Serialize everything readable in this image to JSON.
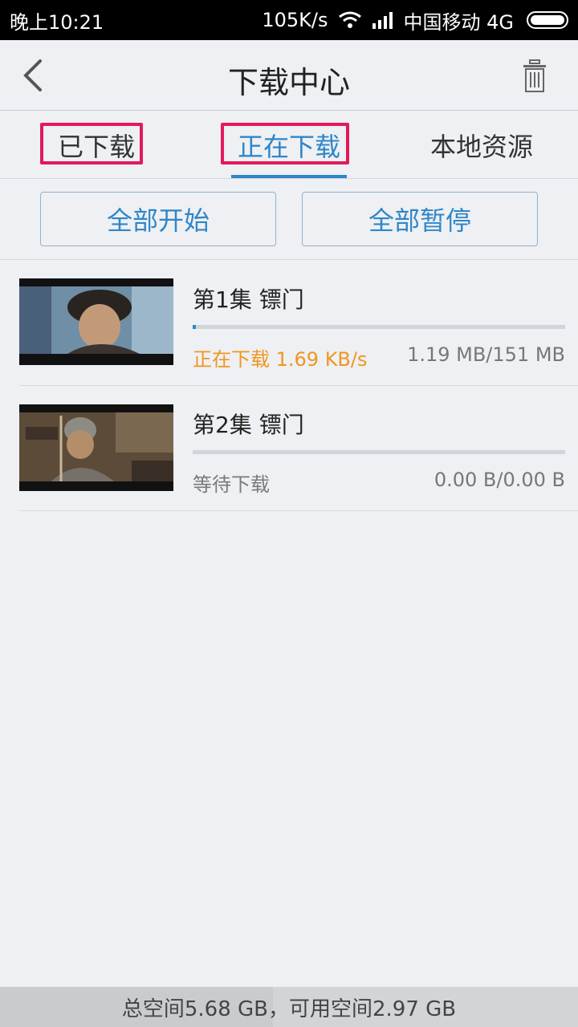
{
  "status_bar": {
    "time": "晚上10:21",
    "speed": "105K/s",
    "carrier": "中国移动 4G"
  },
  "header": {
    "title": "下载中心"
  },
  "tabs": [
    {
      "label": "已下载"
    },
    {
      "label": "正在下载"
    },
    {
      "label": "本地资源"
    }
  ],
  "actions": {
    "start_all": "全部开始",
    "pause_all": "全部暂停"
  },
  "downloads": [
    {
      "title": "第1集  镖门",
      "status": "正在下载  1.69 KB/s",
      "size": "1.19 MB/151 MB",
      "status_color": "#f0961e"
    },
    {
      "title": "第2集  镖门",
      "status": "等待下载",
      "size": "0.00 B/0.00 B",
      "status_color": "#7a7a7a"
    }
  ],
  "footer": {
    "storage": "总空间5.68 GB，可用空间2.97 GB"
  },
  "colors": {
    "accent": "#2f86c8",
    "highlight": "#e3195c"
  }
}
